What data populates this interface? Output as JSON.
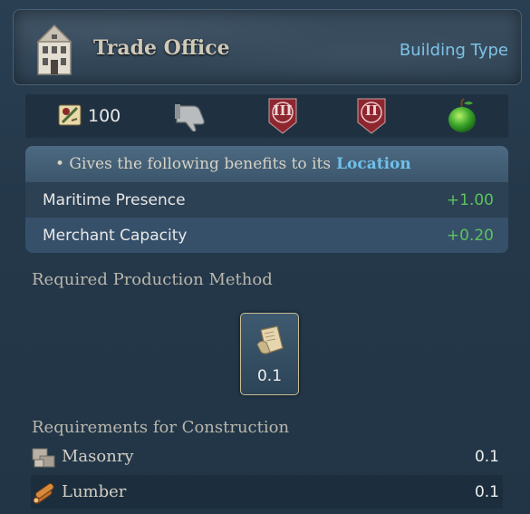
{
  "header": {
    "title": "Trade Office",
    "type_link": "Building Type",
    "icon": "townhouse-icon"
  },
  "stats": {
    "cost_icon": "construction-cost-icon",
    "cost": "100",
    "thumbs_icon": "thumbs-down-icon",
    "tier_a": "III",
    "tier_b": "II",
    "apple_icon": "green-apple-icon"
  },
  "benefits": {
    "intro": "• Gives the following benefits to its",
    "location": "Location",
    "rows": [
      {
        "label": "Maritime Presence",
        "value": "+1.00"
      },
      {
        "label": "Merchant Capacity",
        "value": "+0.20"
      }
    ]
  },
  "production": {
    "label": "Required Production Method",
    "icon": "paper-scroll-icon",
    "value": "0.1"
  },
  "requirements": {
    "label": "Requirements for Construction",
    "items": [
      {
        "name": "Masonry",
        "value": "0.1",
        "icon": "masonry-icon"
      },
      {
        "name": "Lumber",
        "value": "0.1",
        "icon": "lumber-icon"
      }
    ]
  },
  "colors": {
    "accent": "#7dc3e6",
    "positive": "#5cc260",
    "tier_shield": "#8e2630",
    "card_border": "#c9bd93"
  }
}
